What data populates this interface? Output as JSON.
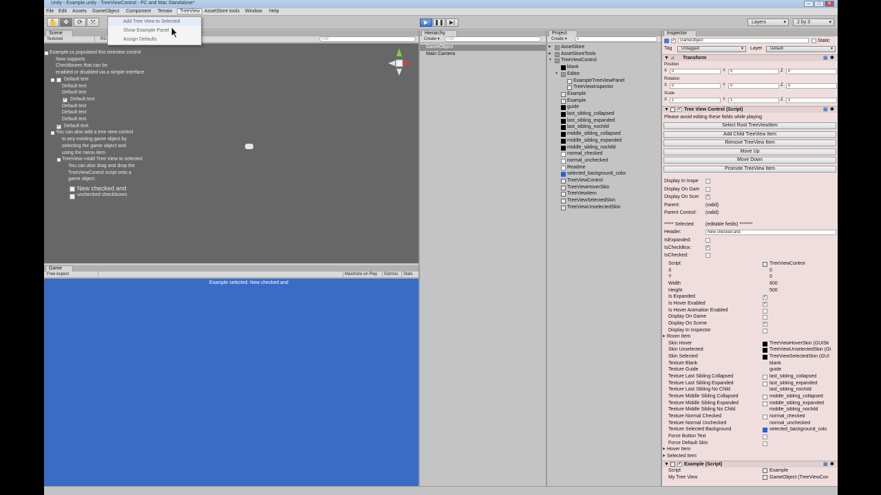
{
  "window": {
    "title": "Unity - Example.unity - TreeViewControl - PC and Mac Standalone*"
  },
  "menu": [
    "File",
    "Edit",
    "Assets",
    "GameObject",
    "Component",
    "Terrain",
    "TreeView",
    "AssetStore tools",
    "Window",
    "Help"
  ],
  "treeview_menu": {
    "items": [
      "Add Tree View to Selected",
      "Show Example Panel",
      "Assign Defaults"
    ],
    "hovered_index": 1
  },
  "toolbar": {
    "layers_label": "Layers",
    "layout_label": "2 by 3"
  },
  "scene": {
    "tab": "Scene",
    "mode_label": "Textured",
    "rgb_label": "RG",
    "search_placeholder": "All",
    "tree_lines": [
      {
        "text": "Example.cs populated this treeview control",
        "indent": 0,
        "expander": "-",
        "checkbox": null
      },
      {
        "text": "Now supports",
        "indent": 1,
        "expander": null,
        "checkbox": null
      },
      {
        "text": "Checkboxes that can be",
        "indent": 1,
        "expander": null,
        "checkbox": null
      },
      {
        "text": "enabled or disabled via a simple interface",
        "indent": 1,
        "expander": null,
        "checkbox": null
      },
      {
        "text": "Default text",
        "indent": 1,
        "expander": "-",
        "checkbox": "unchecked"
      },
      {
        "text": "Default text",
        "indent": 2,
        "expander": null,
        "checkbox": null
      },
      {
        "text": "Default text",
        "indent": 2,
        "expander": null,
        "checkbox": null
      },
      {
        "text": "Default text",
        "indent": 2,
        "expander": null,
        "checkbox": "checked"
      },
      {
        "text": "Default text",
        "indent": 2,
        "expander": null,
        "checkbox": null
      },
      {
        "text": "Default text",
        "indent": 2,
        "expander": null,
        "checkbox": null
      },
      {
        "text": "Default text",
        "indent": 2,
        "expander": null,
        "checkbox": null
      },
      {
        "text": "Default text",
        "indent": 1,
        "expander": null,
        "checkbox": "checked"
      },
      {
        "text": "You can also add a tree view control",
        "indent": 1,
        "expander": "-",
        "checkbox": null
      },
      {
        "text": "to any existing game object by",
        "indent": 2,
        "expander": null,
        "checkbox": null
      },
      {
        "text": "selecting the game object and",
        "indent": 2,
        "expander": null,
        "checkbox": null
      },
      {
        "text": "using the menu item",
        "indent": 2,
        "expander": null,
        "checkbox": null
      },
      {
        "text": "TreeView->Add Tree View to selected",
        "indent": 2,
        "expander": "-",
        "checkbox": null
      },
      {
        "text": "You can also drag and drop the",
        "indent": 3,
        "expander": null,
        "checkbox": null
      },
      {
        "text": "TreeViewControl script onto a",
        "indent": 3,
        "expander": null,
        "checkbox": null
      },
      {
        "text": "game object.",
        "indent": 3,
        "expander": null,
        "checkbox": null
      }
    ],
    "big_items": [
      "New checked and",
      "unchecked checkboxes"
    ]
  },
  "game": {
    "tab": "Game",
    "aspect_label": "Free Aspect",
    "maximize_label": "Maximize on Play",
    "gizmos_label": "Gizmos",
    "stats_label": "Stats",
    "message": "Example selected: New checked and"
  },
  "hierarchy": {
    "tab": "Hierarchy",
    "create_label": "Create",
    "search_placeholder": "All",
    "items": [
      "GameObject",
      "Main Camera"
    ],
    "selected_index": 0
  },
  "project": {
    "tab": "Project",
    "create_label": "Create",
    "items": [
      {
        "name": "AssetStore",
        "indent": 0,
        "icon": "folder-icon",
        "arrow": "▶"
      },
      {
        "name": "AssetStoreTools",
        "indent": 0,
        "icon": "folder-icon",
        "arrow": "▶"
      },
      {
        "name": "TreeViewControl",
        "indent": 0,
        "icon": "folder-icon",
        "arrow": "▼"
      },
      {
        "name": "blank",
        "indent": 1,
        "icon": "black-texture-icon",
        "arrow": ""
      },
      {
        "name": "Editor",
        "indent": 1,
        "icon": "folder-icon",
        "arrow": "▼"
      },
      {
        "name": "ExampleTreeViewPanel",
        "indent": 2,
        "icon": "script-icon",
        "arrow": ""
      },
      {
        "name": "TreeViewInspector",
        "indent": 2,
        "icon": "script-icon",
        "arrow": ""
      },
      {
        "name": "Example",
        "indent": 1,
        "icon": "scene-icon",
        "arrow": ""
      },
      {
        "name": "Example",
        "indent": 1,
        "icon": "script-icon",
        "arrow": ""
      },
      {
        "name": "guide",
        "indent": 1,
        "icon": "black-texture-icon",
        "arrow": ""
      },
      {
        "name": "last_sibling_collapsed",
        "indent": 1,
        "icon": "black-texture-icon",
        "arrow": ""
      },
      {
        "name": "last_sibling_expanded",
        "indent": 1,
        "icon": "black-texture-icon",
        "arrow": ""
      },
      {
        "name": "last_sibling_nochild",
        "indent": 1,
        "icon": "black-texture-icon",
        "arrow": ""
      },
      {
        "name": "middle_sibling_collapsed",
        "indent": 1,
        "icon": "black-texture-icon",
        "arrow": ""
      },
      {
        "name": "middle_sibling_expanded",
        "indent": 1,
        "icon": "black-texture-icon",
        "arrow": ""
      },
      {
        "name": "middle_sibling_nochild",
        "indent": 1,
        "icon": "black-texture-icon",
        "arrow": ""
      },
      {
        "name": "normal_checked",
        "indent": 1,
        "icon": "white-texture-icon",
        "arrow": ""
      },
      {
        "name": "normal_unchecked",
        "indent": 1,
        "icon": "white-texture-icon",
        "arrow": ""
      },
      {
        "name": "Readme",
        "indent": 1,
        "icon": "text-file-icon",
        "arrow": ""
      },
      {
        "name": "selected_background_color",
        "indent": 1,
        "icon": "blue-texture-icon",
        "arrow": ""
      },
      {
        "name": "TreeViewControl",
        "indent": 1,
        "icon": "script-icon",
        "arrow": ""
      },
      {
        "name": "TreeViewHoverSkin",
        "indent": 1,
        "icon": "skin-icon",
        "arrow": ""
      },
      {
        "name": "TreeViewItem",
        "indent": 1,
        "icon": "script-icon",
        "arrow": ""
      },
      {
        "name": "TreeViewSelectedSkin",
        "indent": 1,
        "icon": "skin-icon",
        "arrow": ""
      },
      {
        "name": "TreeViewUnselectedSkin",
        "indent": 1,
        "icon": "skin-icon",
        "arrow": ""
      }
    ]
  },
  "inspector": {
    "tab": "Inspector",
    "object_name": "GameObject",
    "static_label": "Static",
    "tag_label": "Tag",
    "tag_value": "Untagged",
    "layer_label": "Layer",
    "layer_value": "Default",
    "transform": {
      "title": "Transform",
      "position_label": "Position",
      "rotation_label": "Rotation",
      "scale_label": "Scale",
      "axis_x": "X",
      "axis_y": "Y",
      "axis_z": "Z",
      "position": [
        "0",
        "0",
        "0"
      ],
      "rotation": [
        "0",
        "0",
        "0"
      ],
      "scale": [
        "1",
        "1",
        "1"
      ]
    },
    "treeview_script": {
      "title": "Tree View Control (Script)",
      "warning": "Please avoid editing these fields while playing",
      "buttons": [
        "Select Root TreeViewItem",
        "Add Child TreeView Item",
        "Remove TreeView Item",
        "Move Up",
        "Move Down",
        "Promote TreeView Item"
      ],
      "display_inspector_label": "Display In Inspe",
      "display_game_label": "Display On Gam",
      "display_scene_label": "Display On Scer",
      "display_scene_checked": true,
      "parent_label": "Parent:",
      "parent_value": "(valid)",
      "parent_control_label": "Parent Control:",
      "parent_control_value": "(valid)",
      "selected_header": "***** Selected",
      "selected_note": "(editable fields) *******",
      "header_label": "Header:",
      "header_value": "New checked and",
      "is_expanded_label": "IsExpanded:",
      "is_checkbox_label": "IsCheckBox:",
      "is_checked_label": "IsChecked:"
    },
    "props": [
      {
        "label": "Script",
        "value": "TreeViewControl",
        "icon": "script",
        "arrow": "▶"
      },
      {
        "label": "X",
        "value": "0"
      },
      {
        "label": "Y",
        "value": "0"
      },
      {
        "label": "Width",
        "value": "600"
      },
      {
        "label": "Height",
        "value": "500"
      },
      {
        "label": "Is Expanded",
        "value": "",
        "check": true
      },
      {
        "label": "Is Hover Enabled",
        "value": "",
        "check": true
      },
      {
        "label": "Is Hover Animation Enabled",
        "value": "",
        "check": false
      },
      {
        "label": "Display On Game",
        "value": "",
        "check": false
      },
      {
        "label": "Display On Scene",
        "value": "",
        "check": true
      },
      {
        "label": "Display In Inspector",
        "value": "",
        "check": false
      },
      {
        "label": "Room Item",
        "value": "",
        "foldout": true
      },
      {
        "label": "Skin Hover",
        "value": "TreeViewHoverSkin (GUISk",
        "icon": "skin"
      },
      {
        "label": "Skin Unselected",
        "value": "TreeViewUnselectedSkin (Gl",
        "icon": "skin"
      },
      {
        "label": "Skin Selected",
        "value": "TreeViewSelectedSkin (GUI",
        "icon": "skin"
      },
      {
        "label": "Texture Blank",
        "value": "blank"
      },
      {
        "label": "Texture Guide",
        "value": "guide"
      },
      {
        "label": "Texture Last Sibling Collapsed",
        "value": "last_sibling_collapsed",
        "icon": "tex"
      },
      {
        "label": "Texture Last Sibling Expanded",
        "value": "last_sibling_expanded",
        "icon": "tex"
      },
      {
        "label": "Texture Last Sibling No Child",
        "value": "last_sibling_nochild"
      },
      {
        "label": "Texture Middle Sibling Collapsed",
        "value": "middle_sibling_collapsed",
        "icon": "tex"
      },
      {
        "label": "Texture Middle Sibling Expanded",
        "value": "middle_sibling_expanded",
        "icon": "tex"
      },
      {
        "label": "Texture Middle Sibling No Child",
        "value": "middle_sibling_nochild"
      },
      {
        "label": "Texture Normal Checked",
        "value": "normal_checked",
        "icon": "check"
      },
      {
        "label": "Texture Normal Unchecked",
        "value": "normal_unchecked"
      },
      {
        "label": "Texture Selected Background",
        "value": "selected_background_colo",
        "icon": "blue"
      },
      {
        "label": "Force Button Text",
        "value": "",
        "check": false
      },
      {
        "label": "Force Default Skin",
        "value": "",
        "check": false
      },
      {
        "label": "Hover Item",
        "value": "",
        "foldout": true
      },
      {
        "label": "Selected Item",
        "value": "",
        "foldout": true
      }
    ],
    "example_script": {
      "title": "Example (Script)",
      "script_label": "Script",
      "script_value": "Example",
      "my_tree_view_label": "My Tree View",
      "my_tree_view_value": "GameObject (TreeViewCon"
    }
  },
  "colors": {
    "scene_bg": "#676767",
    "game_bg": "#3a6cc6",
    "inspector_bg": "#f0dede",
    "selection": "#3d6ec9"
  }
}
